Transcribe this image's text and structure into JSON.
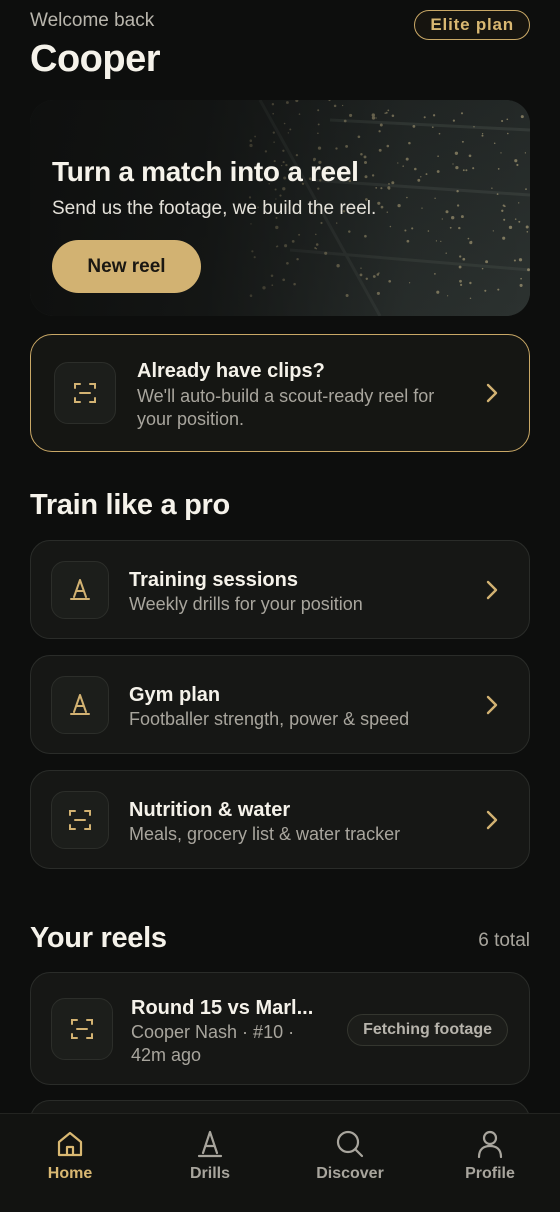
{
  "header": {
    "greeting": "Welcome back",
    "username": "Cooper",
    "plan_badge": "Elite plan"
  },
  "hero": {
    "title": "Turn a match into a reel",
    "subtitle": "Send us the footage, we build the reel.",
    "button_label": "New reel"
  },
  "clips_card": {
    "title": "Already have clips?",
    "description": "We'll auto-build a scout-ready reel for your position.",
    "icon": "scan-frame-icon"
  },
  "train": {
    "heading": "Train like a pro",
    "items": [
      {
        "title": "Training sessions",
        "description": "Weekly drills for your position",
        "icon": "cone-icon"
      },
      {
        "title": "Gym plan",
        "description": "Footballer strength, power & speed",
        "icon": "cone-icon"
      },
      {
        "title": "Nutrition & water",
        "description": "Meals, grocery list & water tracker",
        "icon": "scan-frame-icon"
      }
    ]
  },
  "reels": {
    "heading": "Your reels",
    "count": "6 total",
    "items": [
      {
        "title": "Round 15 vs Marl...",
        "meta": "Cooper Nash · #10 · 42m ago",
        "status": "Fetching footage",
        "icon": "scan-frame-icon"
      }
    ]
  },
  "nav": {
    "items": [
      {
        "label": "Home",
        "icon": "home-icon",
        "active": true
      },
      {
        "label": "Drills",
        "icon": "cone-icon",
        "active": false
      },
      {
        "label": "Discover",
        "icon": "search-icon",
        "active": false
      },
      {
        "label": "Profile",
        "icon": "person-icon",
        "active": false
      }
    ]
  },
  "colors": {
    "accent": "#d2b272",
    "background": "#0d0e0d",
    "card": "#161715",
    "muted_text": "#a8a59d"
  }
}
